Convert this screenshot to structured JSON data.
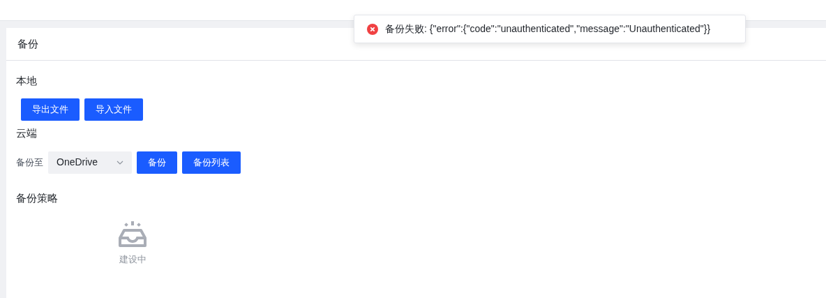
{
  "toast": {
    "kind": "error",
    "message": "备份失败: {\"error\":{\"code\":\"unauthenticated\",\"message\":\"Unauthenticated\"}}"
  },
  "card": {
    "title": "备份"
  },
  "local": {
    "title": "本地",
    "buttons": [
      "导出文件",
      "导入文件"
    ]
  },
  "cloud": {
    "title": "云端",
    "label": "备份至",
    "select": {
      "value": "OneDrive"
    },
    "buttons": [
      "备份",
      "备份列表"
    ]
  },
  "strategy": {
    "title": "备份策略",
    "empty": {
      "text": "建设中"
    }
  }
}
